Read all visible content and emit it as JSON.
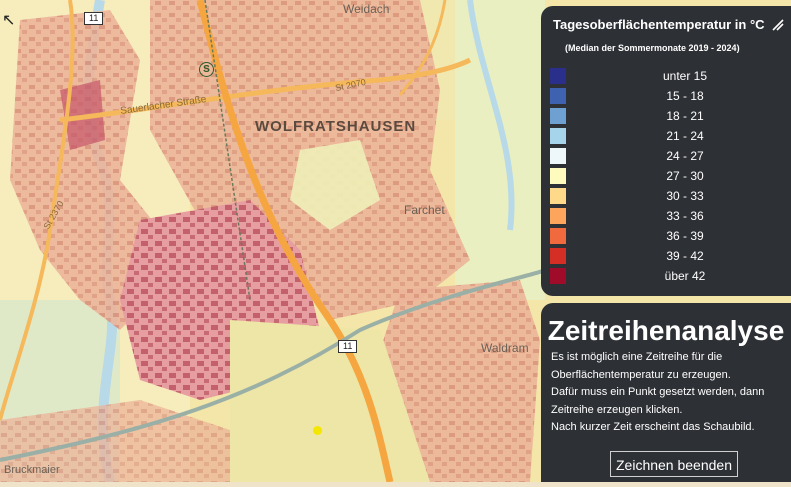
{
  "map": {
    "town_label": "WOLFRATSHAUSEN",
    "place_labels": [
      "Weidach",
      "Farchet",
      "Waldram",
      "Bruckmaier"
    ],
    "road_labels": [
      "Sauerlacher Straße",
      "St 2070",
      "St 2370"
    ],
    "road_shields": [
      "11",
      "11"
    ],
    "station_symbol": "S"
  },
  "legend": {
    "title": "Tagesoberflächentemperatur in °C",
    "subtitle": "(Median der Sommermonate 2019 - 2024)",
    "items": [
      {
        "label": "unter 15",
        "color": "#2a2f8c"
      },
      {
        "label": "15 - 18",
        "color": "#3f62b0"
      },
      {
        "label": "18 - 21",
        "color": "#6fa0d2"
      },
      {
        "label": "21 - 24",
        "color": "#a6d4ea"
      },
      {
        "label": "24 - 27",
        "color": "#eef8fb"
      },
      {
        "label": "27 - 30",
        "color": "#fdfcbc"
      },
      {
        "label": "30 - 33",
        "color": "#fed98a"
      },
      {
        "label": "33 - 36",
        "color": "#fca55b"
      },
      {
        "label": "36 - 39",
        "color": "#f06a3e"
      },
      {
        "label": "39 - 42",
        "color": "#d42e25"
      },
      {
        "label": "über 42",
        "color": "#a00b2a"
      }
    ]
  },
  "timeseries": {
    "heading": "Zeitreihenanalyse",
    "lines": [
      "Es ist möglich eine Zeitreihe für die",
      "Oberflächentemperatur zu erzeugen.",
      "Dafür muss ein Punkt gesetzt werden, dann",
      "Zeitreihe erzeugen klicken.",
      "Nach kurzer Zeit erscheint das Schaubild."
    ],
    "button_label": "Zeichnen beenden"
  }
}
